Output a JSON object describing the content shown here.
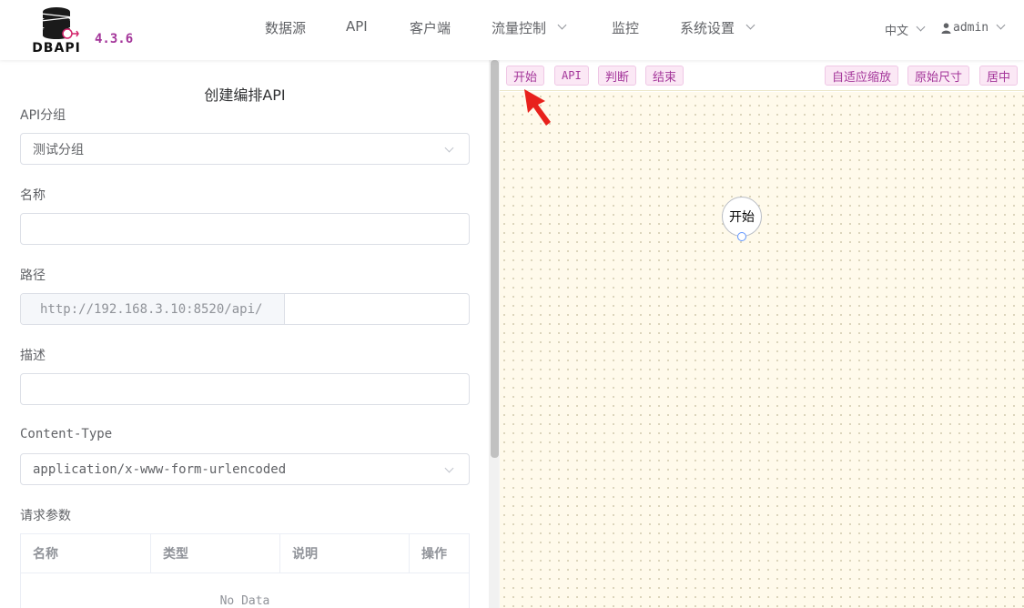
{
  "header": {
    "logo_text": "DBAPI",
    "version": "4.3.6",
    "nav": [
      {
        "label": "数据源",
        "has_dropdown": false
      },
      {
        "label": "API",
        "has_dropdown": false
      },
      {
        "label": "客户端",
        "has_dropdown": false
      },
      {
        "label": "流量控制",
        "has_dropdown": true
      },
      {
        "label": "监控",
        "has_dropdown": false
      },
      {
        "label": "系统设置",
        "has_dropdown": true
      }
    ],
    "language": "中文",
    "user": "admin",
    "user_icon": "user-icon"
  },
  "form": {
    "title": "创建编排API",
    "group_label": "API分组",
    "group_value": "测试分组",
    "name_label": "名称",
    "name_value": "",
    "path_label": "路径",
    "path_prefix": "http://192.168.3.10:8520/api/",
    "path_value": "",
    "desc_label": "描述",
    "desc_value": "",
    "content_type_label": "Content-Type",
    "content_type_value": "application/x-www-form-urlencoded",
    "params_label": "请求参数",
    "params_columns": [
      "名称",
      "类型",
      "说明",
      "操作"
    ],
    "params_empty": "No Data"
  },
  "toolbar": {
    "left_buttons": [
      "开始",
      "API",
      "判断",
      "结束"
    ],
    "right_buttons": [
      "自适应缩放",
      "原始尺寸",
      "居中"
    ]
  },
  "canvas": {
    "start_node_label": "开始",
    "annotation": "red-arrow-icon"
  },
  "colors": {
    "accent": "#a4369a",
    "button_bg": "#fbe8f5",
    "canvas_bg": "#fffaeb",
    "port": "#5f95ff",
    "arrow": "#e8211c"
  }
}
